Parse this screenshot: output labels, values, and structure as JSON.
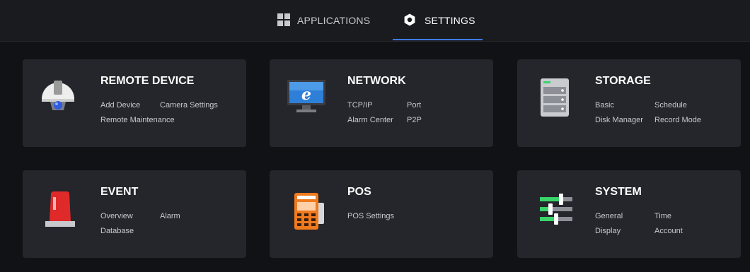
{
  "tabs": {
    "applications": {
      "label": "APPLICATIONS",
      "icon": "grid-icon"
    },
    "settings": {
      "label": "SETTINGS",
      "icon": "gear-icon",
      "active": true
    }
  },
  "colors": {
    "accent": "#3d7bff",
    "card": "#24262c",
    "background": "#111215"
  },
  "cards": {
    "remote_device": {
      "title": "REMOTE DEVICE",
      "icon": "dome-camera-icon",
      "links": [
        "Add Device",
        "Camera Settings",
        "Remote Maintenance"
      ]
    },
    "network": {
      "title": "NETWORK",
      "icon": "monitor-browser-icon",
      "links": [
        "TCP/IP",
        "Port",
        "Alarm Center",
        "P2P"
      ]
    },
    "storage": {
      "title": "STORAGE",
      "icon": "server-icon",
      "links": [
        "Basic",
        "Schedule",
        "Disk Manager",
        "Record Mode"
      ]
    },
    "event": {
      "title": "EVENT",
      "icon": "alarm-light-icon",
      "links": [
        "Overview",
        "Alarm",
        "Database"
      ]
    },
    "pos": {
      "title": "POS",
      "icon": "pos-terminal-icon",
      "links": [
        "POS Settings"
      ]
    },
    "system": {
      "title": "SYSTEM",
      "icon": "sliders-icon",
      "links": [
        "General",
        "Time",
        "Display",
        "Account"
      ]
    }
  }
}
